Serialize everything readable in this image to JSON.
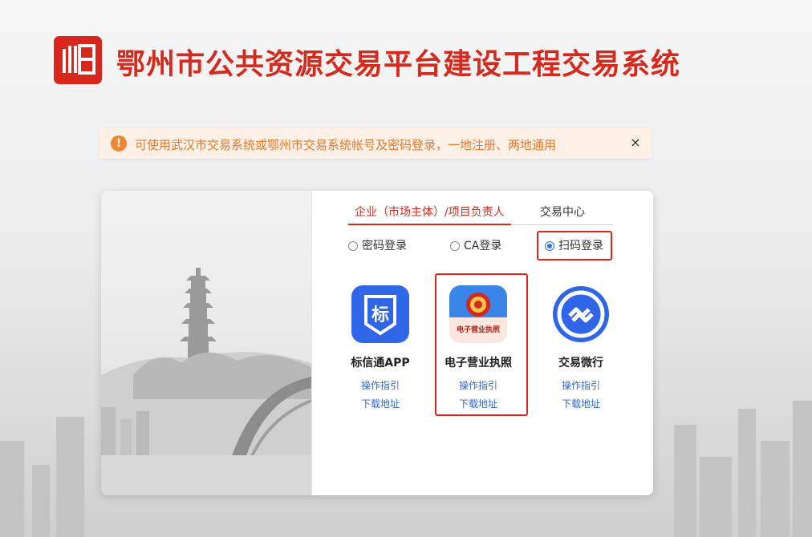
{
  "header": {
    "title": "鄂州市公共资源交易平台建设工程交易系统"
  },
  "notice": {
    "text": "可使用武汉市交易系统或鄂州市交易系统帐号及密码登录，一地注册、两地通用",
    "close": "×",
    "icon_glyph": "!"
  },
  "tabs": [
    {
      "label": "企业（市场主体）/项目负责人",
      "active": true
    },
    {
      "label": "交易中心",
      "active": false
    }
  ],
  "login_methods": [
    {
      "label": "密码登录",
      "checked": false
    },
    {
      "label": "CA登录",
      "checked": false
    },
    {
      "label": "扫码登录",
      "checked": true
    }
  ],
  "apps": [
    {
      "name": "标信通APP",
      "icon_text": "标",
      "guide": "操作指引",
      "download": "下载地址",
      "icon": "biaoxintong-app-icon"
    },
    {
      "name": "电子营业执照",
      "icon_text": "电子营业执照",
      "guide": "操作指引",
      "download": "下载地址",
      "icon": "e-license-app-icon"
    },
    {
      "name": "交易微行",
      "guide": "操作指引",
      "download": "下载地址",
      "icon": "jiaoyi-weixing-app-icon"
    }
  ],
  "colors": {
    "brand_red": "#d52a1e",
    "highlight_red": "#e0241b",
    "link_blue": "#2f66d8",
    "notice_orange": "#e8792b"
  }
}
